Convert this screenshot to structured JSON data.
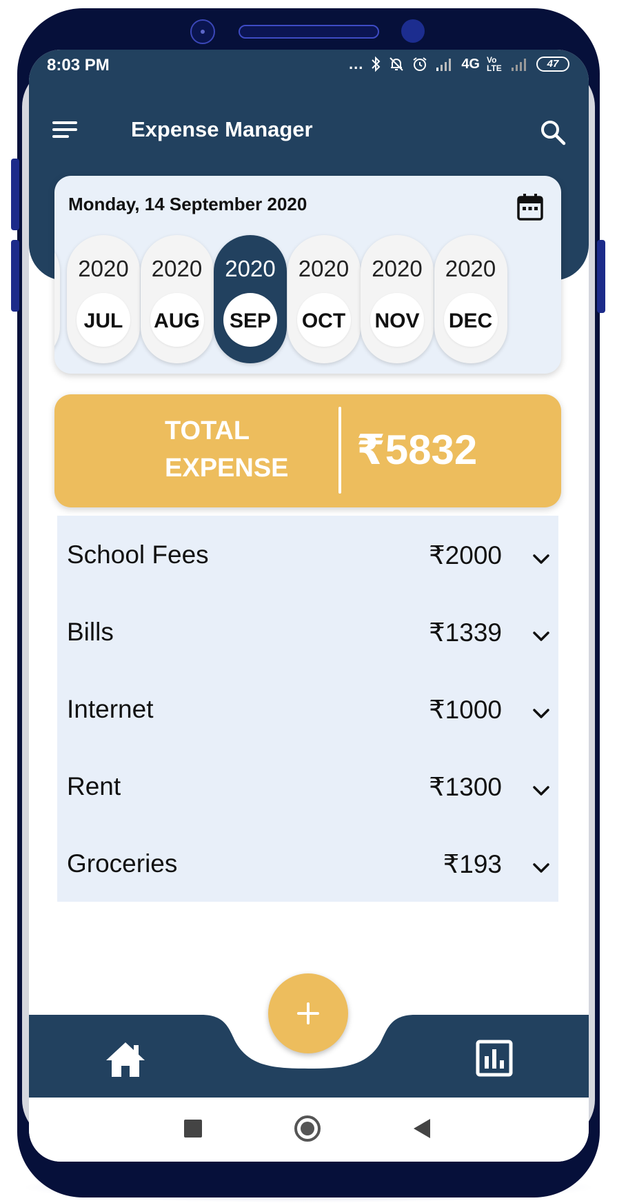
{
  "status_bar": {
    "time": "8:03 PM",
    "dots": "...",
    "network": "4G",
    "volte": "Vo LTE",
    "battery": "47"
  },
  "app_bar": {
    "title": "Expense Manager",
    "menu_icon": "hamburger-menu-icon",
    "search_icon": "search-icon"
  },
  "date_selector": {
    "date_label": "Monday, 14 September 2020",
    "calendar_icon": "calendar-icon",
    "months": [
      {
        "year": "2020",
        "month": "JUL",
        "selected": false
      },
      {
        "year": "2020",
        "month": "AUG",
        "selected": false
      },
      {
        "year": "2020",
        "month": "SEP",
        "selected": true
      },
      {
        "year": "2020",
        "month": "OCT",
        "selected": false
      },
      {
        "year": "2020",
        "month": "NOV",
        "selected": false
      },
      {
        "year": "2020",
        "month": "DEC",
        "selected": false
      }
    ]
  },
  "total": {
    "label": "TOTAL EXPENSE",
    "value": "₹5832"
  },
  "expenses": [
    {
      "name": "School Fees",
      "amount": "₹2000"
    },
    {
      "name": "Bills",
      "amount": "₹1339"
    },
    {
      "name": "Internet",
      "amount": "₹1000"
    },
    {
      "name": "Rent",
      "amount": "₹1300"
    },
    {
      "name": "Groceries",
      "amount": "₹193"
    }
  ],
  "bottom_nav": {
    "fab_icon": "plus-icon",
    "left_icon": "home-icon",
    "right_icon": "bar-chart-icon"
  },
  "colors": {
    "primary": "#22415f",
    "accent": "#edbd5d",
    "card_bg": "#e8eff9"
  }
}
